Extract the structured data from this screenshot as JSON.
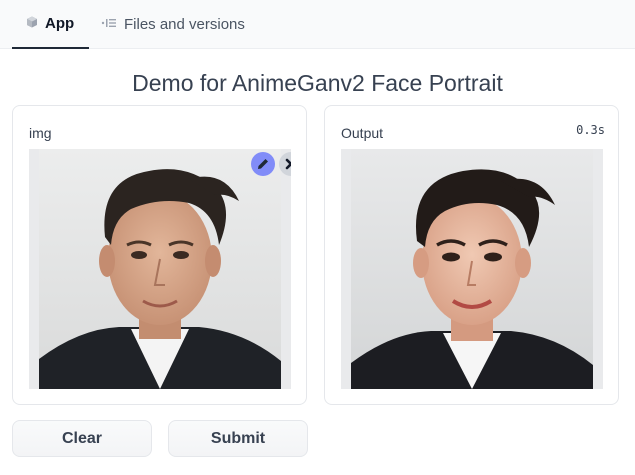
{
  "tabs": [
    {
      "label": "App",
      "icon": "cube-icon",
      "active": true
    },
    {
      "label": "Files and versions",
      "icon": "files-icon",
      "active": false
    }
  ],
  "title": "Demo for AnimeGanv2 Face Portrait",
  "input_panel": {
    "label": "img",
    "image": "photo-portrait",
    "actions": [
      "pencil-icon",
      "close-icon"
    ]
  },
  "output_panel": {
    "label": "Output",
    "timer": "0.3s",
    "image": "anime-portrait"
  },
  "buttons": {
    "clear": "Clear",
    "submit": "Submit"
  },
  "colors": {
    "edit_button": "#818cf8",
    "panel_border": "#e5e7eb",
    "image_bg": "#e9eaec"
  }
}
